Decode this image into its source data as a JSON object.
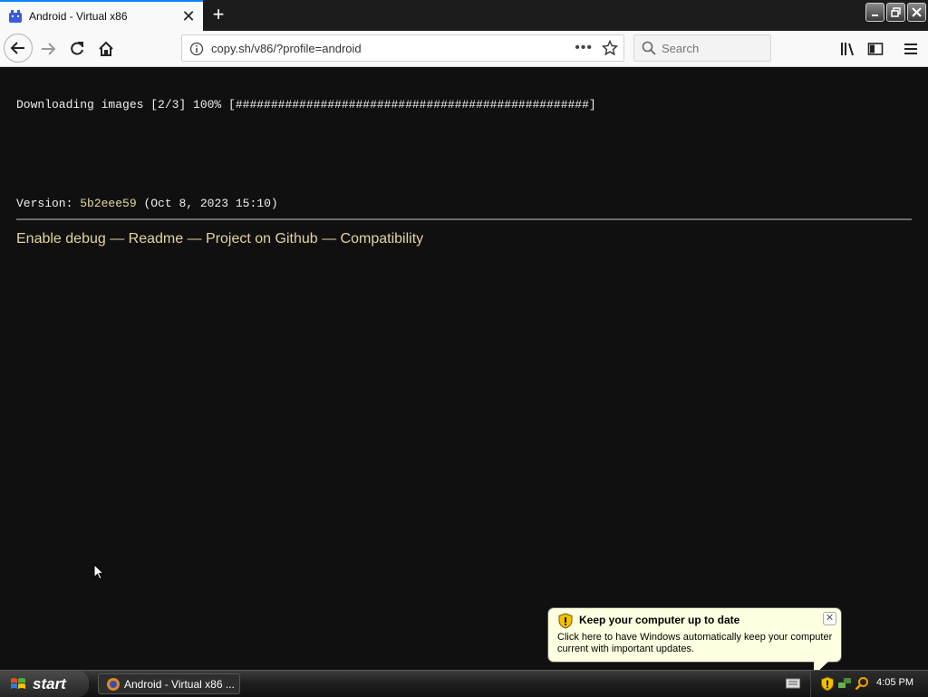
{
  "browser": {
    "tab": {
      "title": "Android - Virtual x86"
    },
    "url": "copy.sh/v86/?profile=android",
    "search": {
      "placeholder": "Search"
    }
  },
  "page": {
    "download_line": "Downloading images [2/3] 100% [##################################################]",
    "version": {
      "prefix": "Version: ",
      "hash": "5b2eee59",
      "suffix": " (Oct 8, 2023 15:10)"
    },
    "links": [
      {
        "label": "Enable debug"
      },
      {
        "label": "Readme"
      },
      {
        "label": "Project on Github"
      },
      {
        "label": "Compatibility"
      }
    ],
    "link_separator": " — "
  },
  "balloon": {
    "title": "Keep your computer up to date",
    "body": "Click here to have Windows automatically keep your computer current with important updates."
  },
  "taskbar": {
    "start_label": "start",
    "task_label": "Android - Virtual x86 ...",
    "clock": "4:05 PM"
  },
  "colors": {
    "page_background": "#101010",
    "link_color": "#e4d4a0",
    "tab_accent": "#0a84ff",
    "balloon_background": "#ffffe1"
  }
}
